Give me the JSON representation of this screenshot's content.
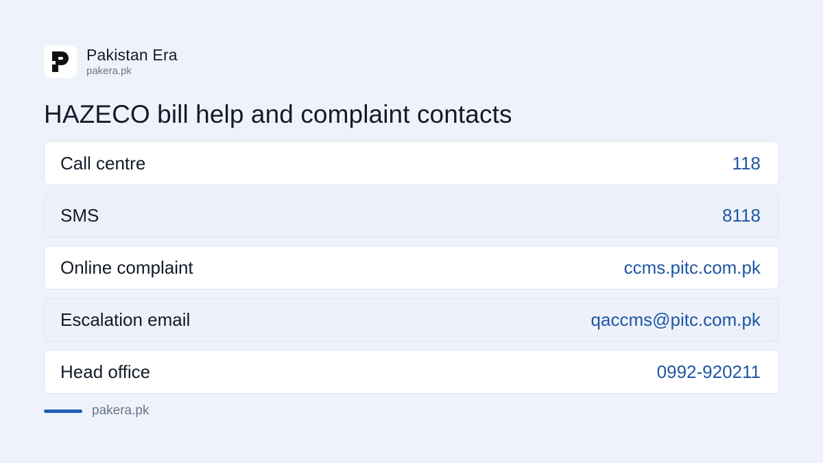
{
  "brand": {
    "name": "Pakistan Era",
    "domain": "pakera.pk",
    "logo_icon": "pakera-logo-icon"
  },
  "title": "HAZECO bill help and complaint contacts",
  "contacts": [
    {
      "label": "Call centre",
      "value": "118"
    },
    {
      "label": "SMS",
      "value": "8118"
    },
    {
      "label": "Online complaint",
      "value": "ccms.pitc.com.pk"
    },
    {
      "label": "Escalation email",
      "value": "qaccms@pitc.com.pk"
    },
    {
      "label": "Head office",
      "value": "0992-920211"
    }
  ],
  "footer": {
    "text": "pakera.pk"
  },
  "colors": {
    "background": "#eef3fb",
    "accent": "#1f5bb5",
    "value_text": "#1f56a3",
    "row_alt": "#edf2fa"
  }
}
